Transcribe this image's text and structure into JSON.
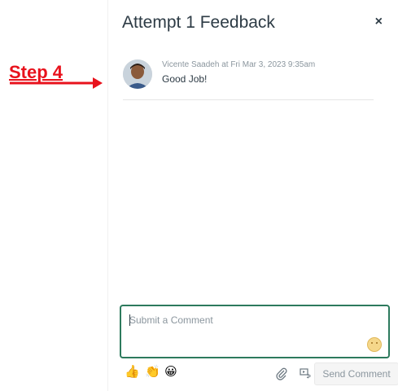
{
  "annotation": {
    "step_label": "Step 4"
  },
  "panel": {
    "title": "Attempt 1 Feedback",
    "close_label": "×"
  },
  "comments": [
    {
      "meta": "Vicente Saadeh at Fri Mar 3, 2023 9:35am",
      "text": "Good Job!"
    }
  ],
  "comment_box": {
    "placeholder": "Submit a Comment",
    "value": ""
  },
  "toolbar": {
    "quick_emojis": [
      "👍",
      "👏",
      "😀"
    ],
    "send_label": "Send Comment"
  },
  "colors": {
    "annotation_red": "#e8121c",
    "focus_border": "#2d7a5d",
    "text_primary": "#2d3b45",
    "text_muted": "#8b969e"
  }
}
